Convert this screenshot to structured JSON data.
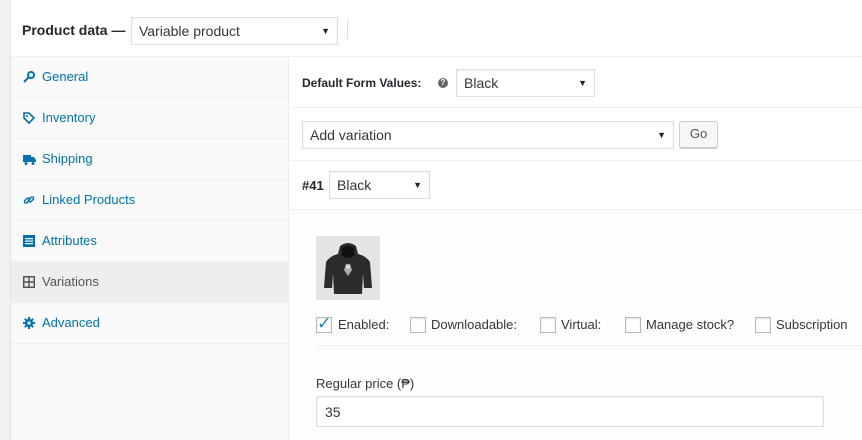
{
  "header": {
    "title": "Product data —",
    "product_type": "Variable product"
  },
  "sidebar": {
    "items": [
      {
        "label": "General",
        "icon": "wrench-icon"
      },
      {
        "label": "Inventory",
        "icon": "tag-icon"
      },
      {
        "label": "Shipping",
        "icon": "truck-icon"
      },
      {
        "label": "Linked Products",
        "icon": "link-icon"
      },
      {
        "label": "Attributes",
        "icon": "list-icon"
      },
      {
        "label": "Variations",
        "icon": "grid-icon",
        "active": true
      },
      {
        "label": "Advanced",
        "icon": "gear-icon"
      }
    ]
  },
  "defaults": {
    "label": "Default Form Values:",
    "help": "?",
    "value": "Black"
  },
  "add_variation": {
    "select_value": "Add variation",
    "go_label": "Go"
  },
  "variation": {
    "number": "#41",
    "attribute_value": "Black",
    "options": [
      {
        "label": "Enabled:",
        "checked": true
      },
      {
        "label": "Downloadable:",
        "checked": false
      },
      {
        "label": "Virtual:",
        "checked": false
      },
      {
        "label": "Manage stock?",
        "checked": false
      },
      {
        "label": "Subscription",
        "checked": false
      }
    ],
    "regular_price_label": "Regular price (₱)",
    "regular_price_value": "35"
  },
  "colors": {
    "link": "#0073aa",
    "checkbox_tick": "#1e8cbe"
  }
}
